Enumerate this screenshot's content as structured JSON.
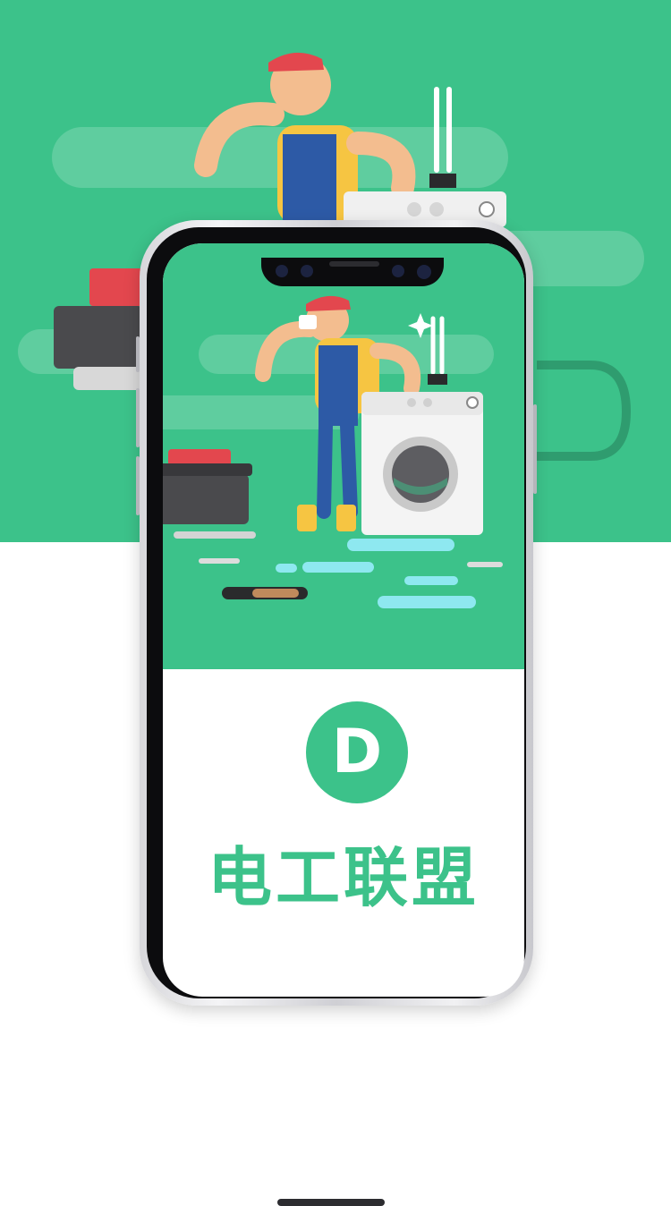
{
  "brand": {
    "logo_letter": "D",
    "name": "电工联盟"
  },
  "colors": {
    "primary": "#3cc28a",
    "white": "#ffffff",
    "phone_frame": "#0c0c0e"
  },
  "illustration": {
    "subject": "handyman-fixing-washing-machine-illustration"
  }
}
